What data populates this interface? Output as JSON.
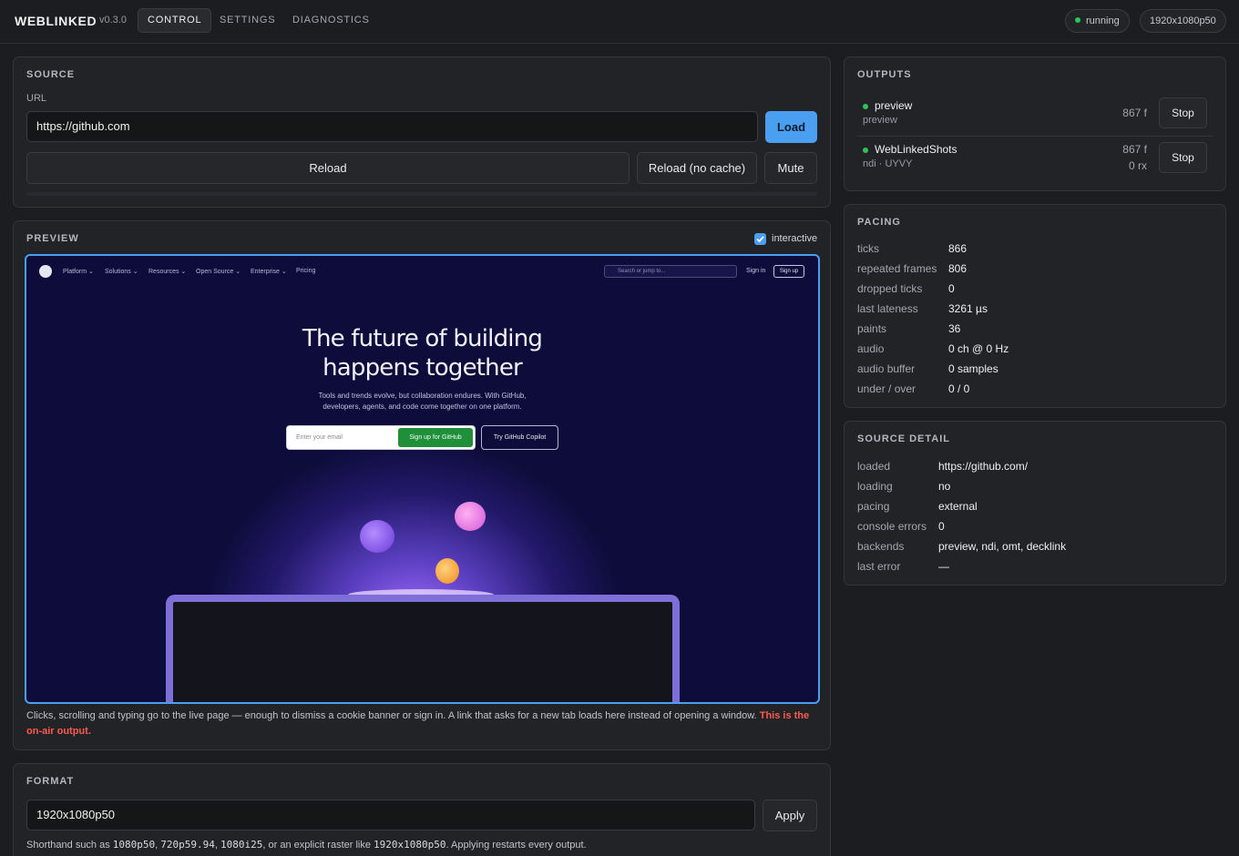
{
  "app": {
    "brand": "WEBLINKED",
    "version": "v0.3.0"
  },
  "tabs": [
    {
      "label": "CONTROL",
      "active": true
    },
    {
      "label": "SETTINGS",
      "active": false
    },
    {
      "label": "DIAGNOSTICS",
      "active": false
    }
  ],
  "status": {
    "state": "running",
    "format": "1920x1080p50"
  },
  "source": {
    "title": "SOURCE",
    "url_label": "URL",
    "url_value": "https://github.com",
    "load_label": "Load",
    "reload_label": "Reload",
    "reload_nocache_label": "Reload (no cache)",
    "mute_label": "Mute"
  },
  "preview": {
    "title": "PREVIEW",
    "interactive_label": "interactive",
    "interactive_checked": true,
    "note": "Clicks, scrolling and typing go to the live page — enough to dismiss a cookie banner or sign in. A link that asks for a new tab loads here instead of opening a window.",
    "warning": "This is the on-air output.",
    "page": {
      "nav": [
        "Platform ⌄",
        "Solutions ⌄",
        "Resources ⌄",
        "Open Source ⌄",
        "Enterprise ⌄",
        "Pricing"
      ],
      "search_placeholder": "Search or jump to...",
      "sign_in": "Sign in",
      "sign_up": "Sign up",
      "headline_1": "The future of building",
      "headline_2": "happens together",
      "sub_1": "Tools and trends evolve, but collaboration endures. With GitHub,",
      "sub_2": "developers, agents, and code come together on one platform.",
      "email_placeholder": "Enter your email",
      "signup_button": "Sign up for GitHub",
      "copilot_button": "Try GitHub Copilot"
    }
  },
  "format": {
    "title": "FORMAT",
    "value": "1920x1080p50",
    "apply_label": "Apply",
    "help_pre": "Shorthand such as",
    "ex1": "1080p50",
    "sep1": ",",
    "ex2": "720p59.94",
    "sep2": ",",
    "ex3": "1080i25",
    "help_mid": ", or an explicit raster like",
    "ex4": "1920x1080p50",
    "help_post": ". Applying restarts every output."
  },
  "outputs": {
    "title": "OUTPUTS",
    "items": [
      {
        "name": "preview",
        "sub": "preview",
        "frames": "867 f",
        "rx": "",
        "stop_label": "Stop"
      },
      {
        "name": "WebLinkedShots",
        "sub": "ndi · UYVY",
        "frames": "867 f",
        "rx": "0 rx",
        "stop_label": "Stop"
      }
    ]
  },
  "pacing": {
    "title": "PACING",
    "rows": [
      {
        "key": "ticks",
        "value": "866"
      },
      {
        "key": "repeated frames",
        "value": "806"
      },
      {
        "key": "dropped ticks",
        "value": "0"
      },
      {
        "key": "last lateness",
        "value": "3261 µs"
      },
      {
        "key": "paints",
        "value": "36"
      },
      {
        "key": "audio",
        "value": "0 ch @ 0 Hz"
      },
      {
        "key": "audio buffer",
        "value": "0 samples"
      },
      {
        "key": "under / over",
        "value": "0 / 0"
      }
    ]
  },
  "source_detail": {
    "title": "SOURCE DETAIL",
    "rows": [
      {
        "key": "loaded",
        "value": "https://github.com/"
      },
      {
        "key": "loading",
        "value": "no"
      },
      {
        "key": "pacing",
        "value": "external"
      },
      {
        "key": "console errors",
        "value": "0"
      },
      {
        "key": "backends",
        "value": "preview, ndi, omt, decklink"
      },
      {
        "key": "last error",
        "value": "—"
      }
    ]
  },
  "colors": {
    "accent": "#4a9ff0",
    "ok": "#2fc25b",
    "warn": "#ff5a4f",
    "bg": "#1c1d20",
    "panel": "#222327"
  }
}
